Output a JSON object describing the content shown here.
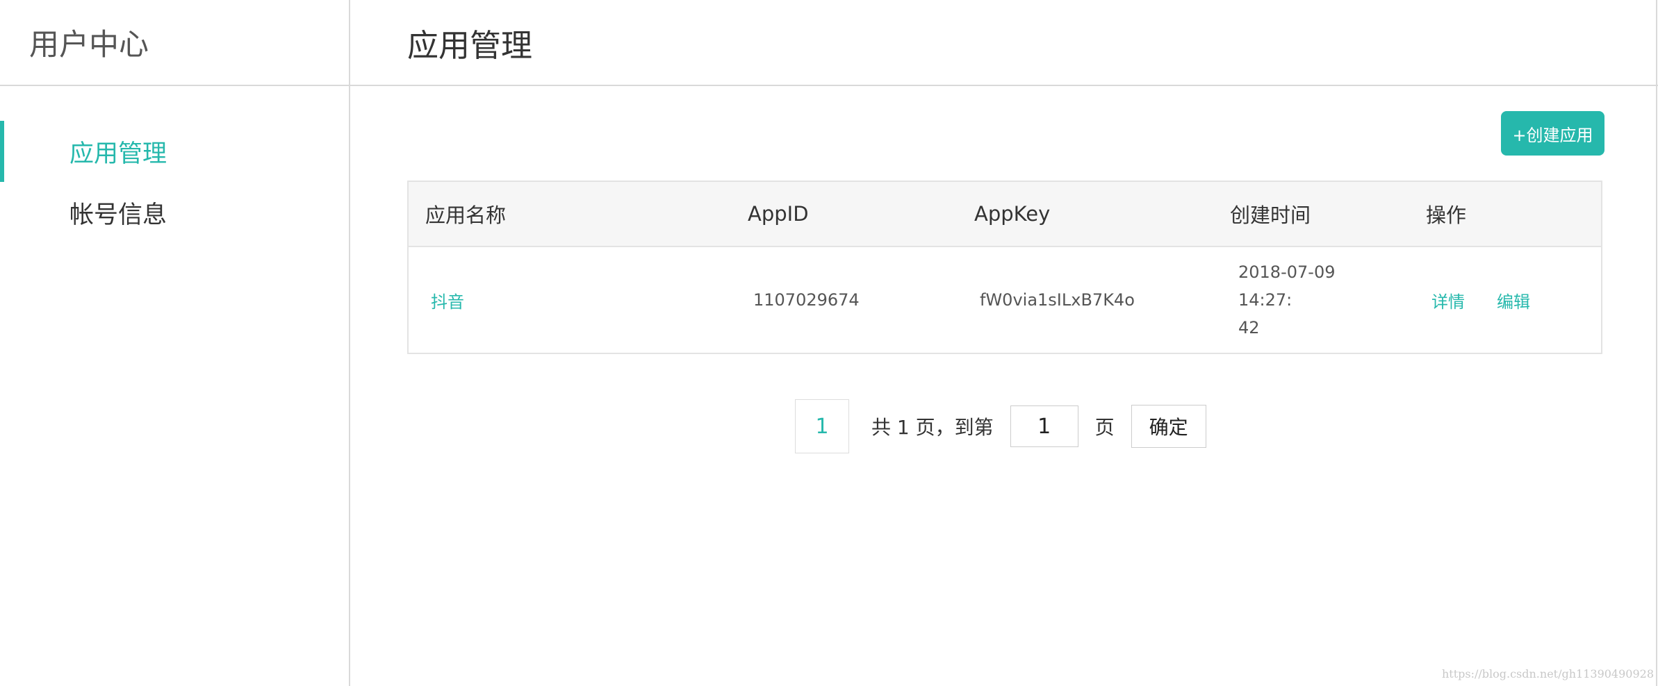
{
  "sidebar": {
    "title": "用户中心",
    "items": [
      {
        "label": "应用管理",
        "active": true
      },
      {
        "label": "帐号信息",
        "active": false
      }
    ]
  },
  "main": {
    "title": "应用管理",
    "create_button_label": "+创建应用"
  },
  "table": {
    "columns": [
      "应用名称",
      "AppID",
      "AppKey",
      "创建时间",
      "操作"
    ],
    "rows": [
      {
        "name": "抖音",
        "appid": "1107029674",
        "appkey": "fW0via1sILxB7K4o",
        "created_line1": "2018-07-09 14:27:",
        "created_line2": "42",
        "actions": [
          "详情",
          "编辑"
        ]
      }
    ]
  },
  "pagination": {
    "current_page": "1",
    "total_text": "共 1 页，到第",
    "goto_value": "1",
    "page_unit": "页",
    "confirm_label": "确定"
  },
  "watermark": "https://blog.csdn.net/gh11390490928",
  "colors": {
    "accent": "#26b8ac",
    "border": "#d9d9d9",
    "table_header_bg": "#f6f6f6"
  }
}
